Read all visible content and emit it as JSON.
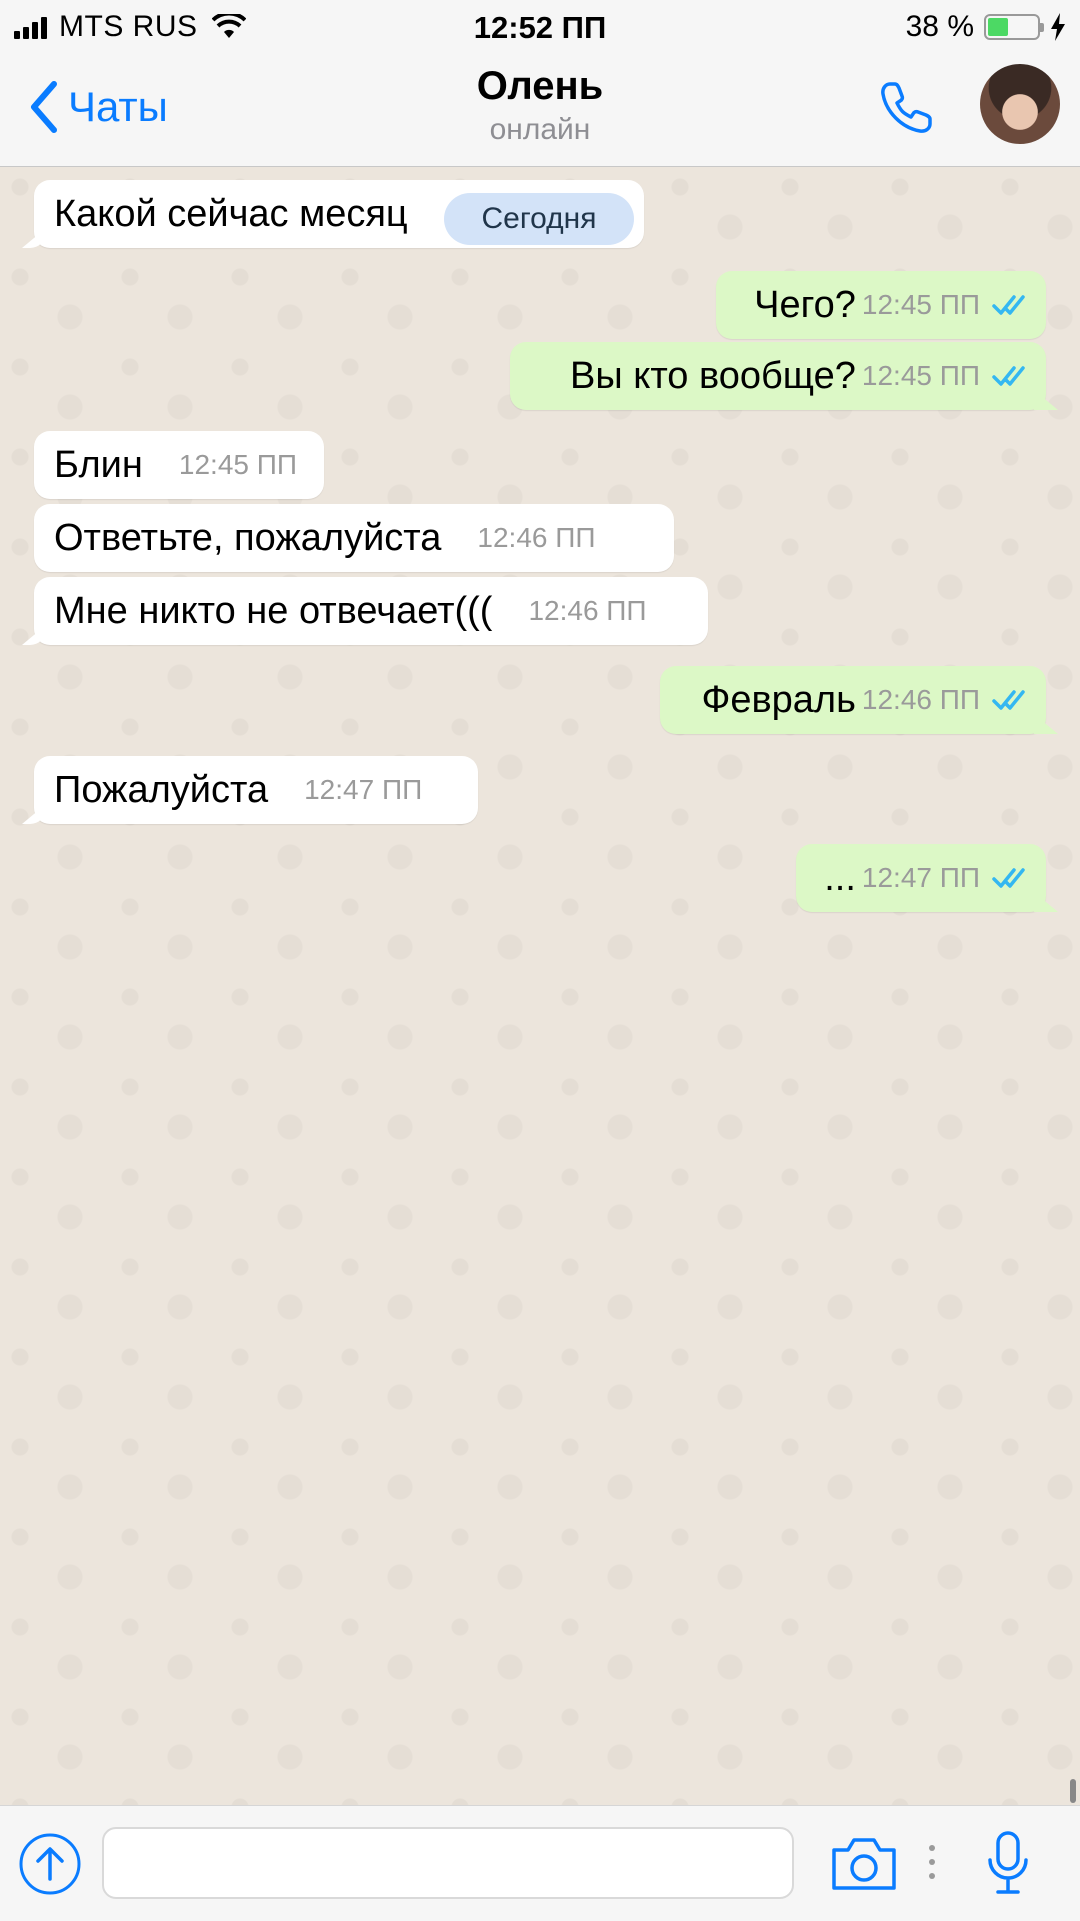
{
  "status_bar": {
    "carrier": "MTS RUS",
    "time": "12:52 ПП",
    "battery_text": "38 %",
    "battery_level": 0.38
  },
  "nav": {
    "back_label": "Чаты",
    "title": "Олень",
    "status": "онлайн"
  },
  "date_pill": "Сегодня",
  "messages": [
    {
      "direction": "in",
      "text": "Какой сейчас месяц",
      "time": ""
    },
    {
      "direction": "out",
      "text": "Чего?",
      "time": "12:45 ПП"
    },
    {
      "direction": "out",
      "text": "Вы кто вообще?",
      "time": "12:45 ПП"
    },
    {
      "direction": "in",
      "text": "Блин",
      "time": "12:45 ПП"
    },
    {
      "direction": "in",
      "text": "Ответьте, пожалуйста",
      "time": "12:46 ПП"
    },
    {
      "direction": "in",
      "text": "Мне никто не отвечает(((",
      "time": "12:46 ПП"
    },
    {
      "direction": "out",
      "text": "Февраль",
      "time": "12:46 ПП"
    },
    {
      "direction": "in",
      "text": "Пожалуйста",
      "time": "12:47 ПП"
    },
    {
      "direction": "out",
      "text": "...",
      "time": "12:47 ПП"
    }
  ],
  "input": {
    "placeholder": ""
  },
  "colors": {
    "accent": "#0a7cff",
    "outgoing_bubble": "#dcf8c6",
    "incoming_bubble": "#ffffff",
    "chat_background": "#ece5dc",
    "read_ticks": "#34b7f1",
    "date_pill": "#d3e3f8"
  },
  "icons": [
    "signal-icon",
    "wifi-icon",
    "battery-icon",
    "charging-icon",
    "back-chevron-icon",
    "phone-icon",
    "avatar",
    "double-check-icon",
    "attach-up-arrow-icon",
    "camera-icon",
    "more-dots-icon",
    "microphone-icon"
  ]
}
